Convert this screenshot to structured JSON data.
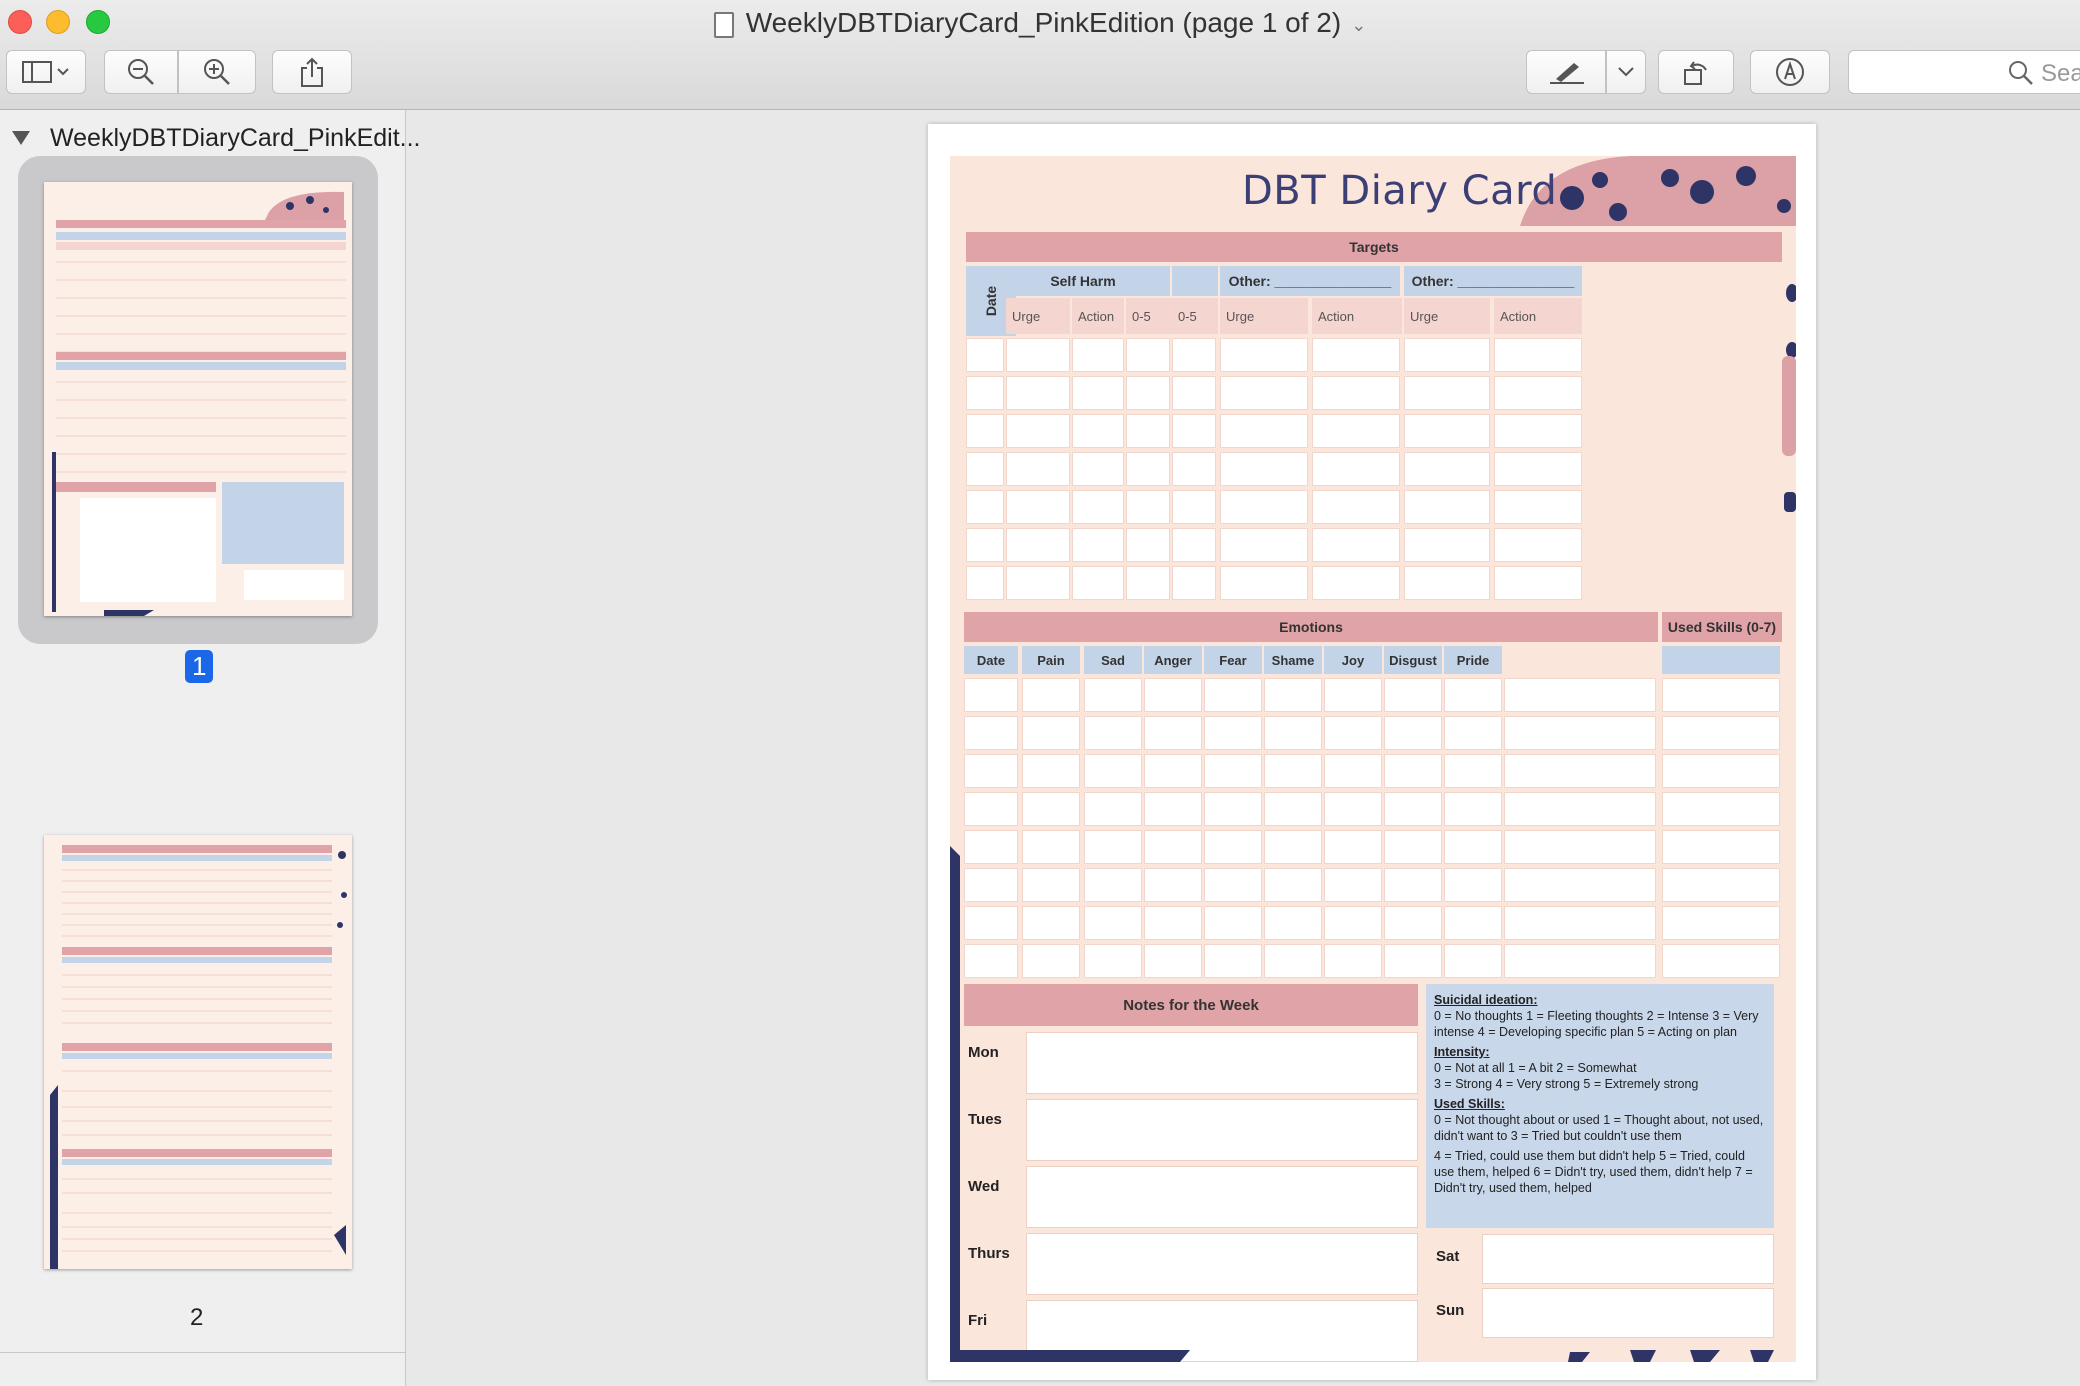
{
  "window": {
    "title": "WeeklyDBTDiaryCard_PinkEdition (page 1 of 2)",
    "search_placeholder": "Sea"
  },
  "sidebar": {
    "doc_name": "WeeklyDBTDiaryCard_PinkEdit...",
    "pages": [
      {
        "label": "1"
      },
      {
        "label": "2"
      }
    ]
  },
  "icons": {
    "sidebar_toggle": "sidebar-icon",
    "zoom_out": "zoom-out-icon",
    "zoom_in": "zoom-in-icon",
    "share": "share-icon",
    "markup": "markup-pen-icon",
    "rotate": "rotate-icon",
    "annotate": "annotate-icon",
    "search": "search-icon"
  },
  "colors": {
    "band_pink": "#dfa3a8",
    "header_blue": "#c4d4e8",
    "sheet_bg": "#fbe6dc",
    "title_navy": "#3b3f75",
    "selected_page": "#1a67e8"
  },
  "card": {
    "title": "DBT Diary Card",
    "targets": {
      "band": "Targets",
      "date": "Date",
      "groups": [
        "Self Harm",
        "",
        "",
        "Other: _______________",
        "Other: _______________"
      ],
      "subheaders": [
        "Urge",
        "Action",
        "0-5",
        "0-5",
        "Urge",
        "Action",
        "Urge",
        "Action"
      ]
    },
    "emotions": {
      "band": "Emotions",
      "used_skills": "Used Skills (0-7)",
      "columns": [
        "Date",
        "Pain",
        "Sad",
        "Anger",
        "Fear",
        "Shame",
        "Joy",
        "Disgust",
        "Pride"
      ]
    },
    "notes": {
      "band": "Notes for the Week",
      "days": [
        "Mon",
        "Tues",
        "Wed",
        "Thurs",
        "Fri"
      ],
      "days_right": [
        "Sat",
        "Sun"
      ]
    },
    "legend": {
      "suicidal_title": "Suicidal ideation:",
      "suicidal_text": "0 = No thoughts 1 = Fleeting thoughts 2 = Intense 3 = Very intense 4 = Developing specific plan  5 = Acting on plan",
      "intensity_title": "Intensity:",
      "intensity_line1": "0 = Not at all  1 = A bit  2 = Somewhat",
      "intensity_line2": "3 = Strong 4 = Very strong 5 = Extremely strong",
      "skills_title": "Used Skills:",
      "skills_text1": "0 = Not thought about or used 1 = Thought about, not used, didn't want to 3 = Tried but couldn't use them",
      "skills_text2": "4 = Tried, could use them but didn't help 5 = Tried, could use them, helped 6 = Didn't try, used them, didn't help 7 = Didn't try, used them, helped"
    }
  }
}
